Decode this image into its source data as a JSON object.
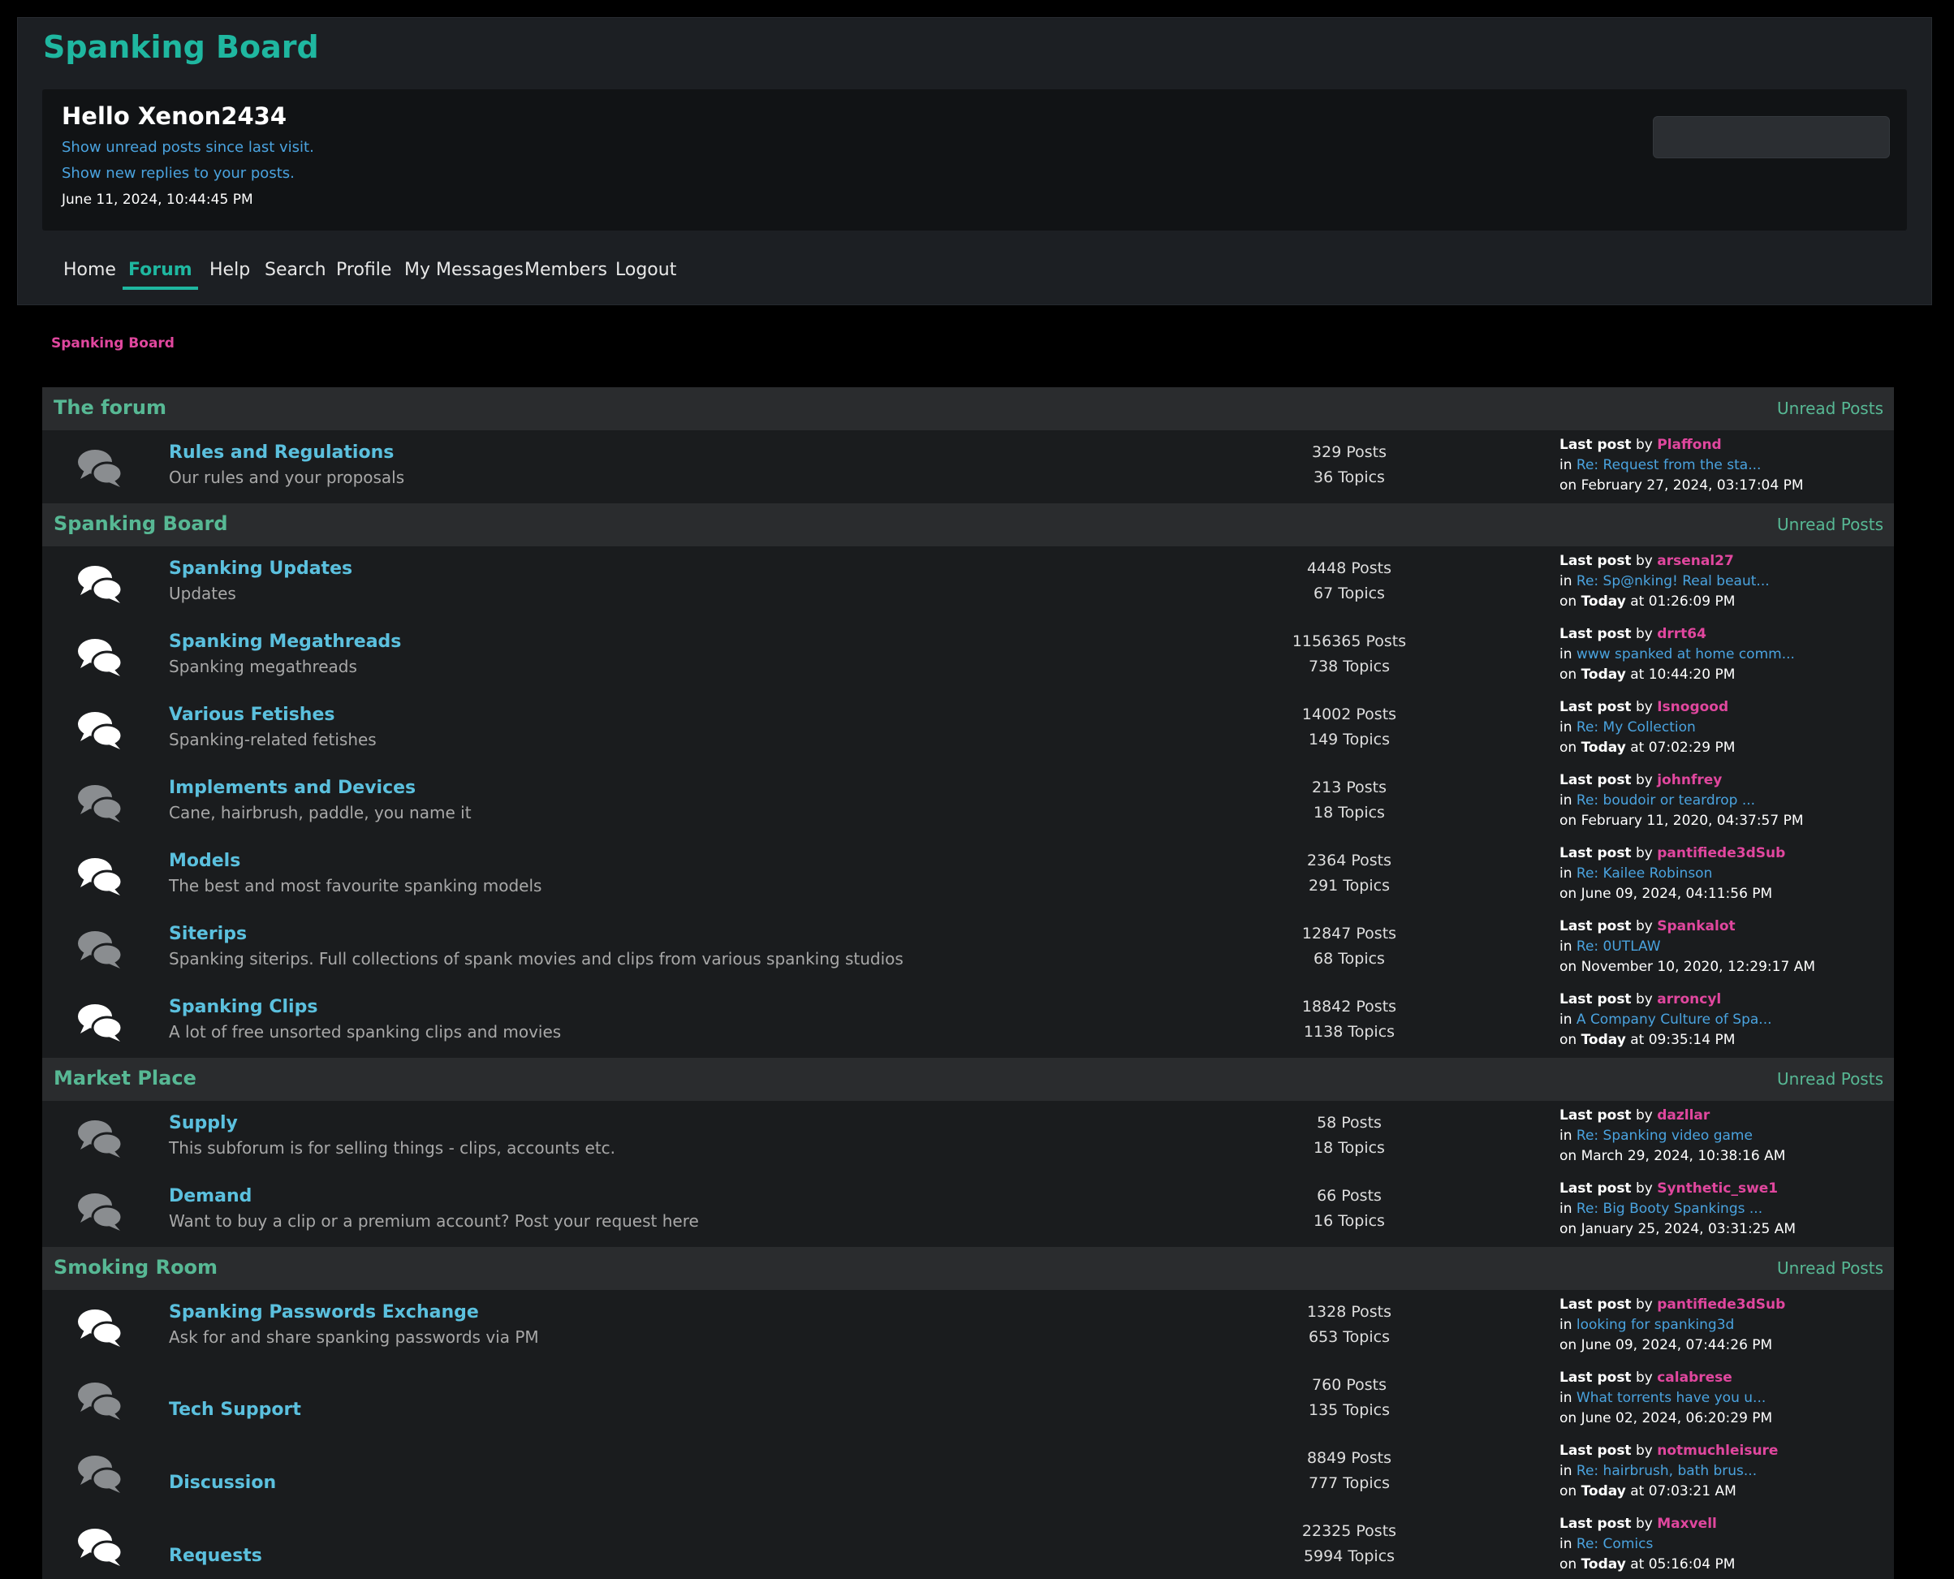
{
  "header": {
    "forum_title": "Spanking Board",
    "greeting": "Hello Xenon2434",
    "unread_link": "Show unread posts since last visit.",
    "replies_link": "Show new replies to your posts.",
    "datetime": "June 11, 2024, 10:44:45 PM"
  },
  "nav": {
    "items": [
      {
        "label": "Home",
        "active": false
      },
      {
        "label": "Forum",
        "active": true
      },
      {
        "label": "Help",
        "active": false
      },
      {
        "label": "Search",
        "active": false
      },
      {
        "label": "Profile",
        "active": false
      },
      {
        "label": "My Messages",
        "active": false
      },
      {
        "label": "Members",
        "active": false
      },
      {
        "label": "Logout",
        "active": false
      }
    ]
  },
  "breadcrumb": "Spanking Board",
  "labels": {
    "last_post": "Last post",
    "by": "by",
    "in": "in",
    "on": "on",
    "unread_posts": "Unread Posts"
  },
  "icons": {
    "board_unread": "speech-bubbles-icon-white",
    "board_read": "speech-bubbles-icon-grey"
  },
  "colors": {
    "accent": "#1fb7a0",
    "category": "#57b894",
    "link": "#4aa3df",
    "board_name": "#5bc0de",
    "poster": "#e0479e"
  },
  "categories": [
    {
      "title": "The forum",
      "boards": [
        {
          "name": "Rules and Regulations",
          "desc": "Our rules and your proposals",
          "posts": "329 Posts",
          "topics": "36 Topics",
          "new": false,
          "last": {
            "by": "Plaffond",
            "topic": "Re: Request from the sta...",
            "date_bold": "",
            "date": "February 27, 2024, 03:17:04 PM"
          }
        }
      ]
    },
    {
      "title": "Spanking Board",
      "boards": [
        {
          "name": "Spanking Updates",
          "desc": "Updates",
          "posts": "4448 Posts",
          "topics": "67 Topics",
          "new": true,
          "last": {
            "by": "arsenal27",
            "topic": "Re: Sp@nking! Real beaut...",
            "date_bold": "Today",
            "date": " at 01:26:09 PM"
          }
        },
        {
          "name": "Spanking Megathreads",
          "desc": "Spanking megathreads",
          "posts": "1156365 Posts",
          "topics": "738 Topics",
          "new": true,
          "last": {
            "by": "drrt64",
            "topic": "www spanked at home comm...",
            "date_bold": "Today",
            "date": " at 10:44:20 PM"
          }
        },
        {
          "name": "Various Fetishes",
          "desc": "Spanking-related fetishes",
          "posts": "14002 Posts",
          "topics": "149 Topics",
          "new": true,
          "last": {
            "by": "Isnogood",
            "topic": "Re: My Collection",
            "date_bold": "Today",
            "date": " at 07:02:29 PM"
          }
        },
        {
          "name": "Implements and Devices",
          "desc": "Cane, hairbrush, paddle, you name it",
          "posts": "213 Posts",
          "topics": "18 Topics",
          "new": false,
          "last": {
            "by": "johnfrey",
            "topic": "Re: boudoir or teardrop ...",
            "date_bold": "",
            "date": "February 11, 2020, 04:37:57 PM"
          }
        },
        {
          "name": "Models",
          "desc": "The best and most favourite spanking models",
          "posts": "2364 Posts",
          "topics": "291 Topics",
          "new": true,
          "last": {
            "by": "pantifiede3dSub",
            "topic": "Re: Kailee Robinson",
            "date_bold": "",
            "date": "June 09, 2024, 04:11:56 PM"
          }
        },
        {
          "name": "Siterips",
          "desc": "Spanking siterips. Full collections of spank movies and clips from various spanking studios",
          "posts": "12847 Posts",
          "topics": "68 Topics",
          "new": false,
          "last": {
            "by": "Spankalot",
            "topic": "Re: 0UTLAW",
            "date_bold": "",
            "date": "November 10, 2020, 12:29:17 AM"
          }
        },
        {
          "name": "Spanking Clips",
          "desc": "A lot of free unsorted spanking clips and movies",
          "posts": "18842 Posts",
          "topics": "1138 Topics",
          "new": true,
          "last": {
            "by": "arroncyl",
            "topic": "A Company Culture of Spa...",
            "date_bold": "Today",
            "date": " at 09:35:14 PM"
          }
        }
      ]
    },
    {
      "title": "Market Place",
      "boards": [
        {
          "name": "Supply",
          "desc": "This subforum is for selling things - clips, accounts etc.",
          "posts": "58 Posts",
          "topics": "18 Topics",
          "new": false,
          "last": {
            "by": "dazllar",
            "topic": "Re: Spanking video game",
            "date_bold": "",
            "date": "March 29, 2024, 10:38:16 AM"
          }
        },
        {
          "name": "Demand",
          "desc": "Want to buy a clip or a premium account? Post your request here",
          "posts": "66 Posts",
          "topics": "16 Topics",
          "new": false,
          "last": {
            "by": "Synthetic_swe1",
            "topic": "Re: Big Booty Spankings ...",
            "date_bold": "",
            "date": "January 25, 2024, 03:31:25 AM"
          }
        }
      ]
    },
    {
      "title": "Smoking Room",
      "boards": [
        {
          "name": "Spanking Passwords Exchange",
          "desc": "Ask for and share spanking passwords via PM",
          "posts": "1328 Posts",
          "topics": "653 Topics",
          "new": true,
          "last": {
            "by": "pantifiede3dSub",
            "topic": "looking for spanking3d",
            "date_bold": "",
            "date": "June 09, 2024, 07:44:26 PM"
          }
        },
        {
          "name": "Tech Support",
          "desc": "",
          "posts": "760 Posts",
          "topics": "135 Topics",
          "new": false,
          "last": {
            "by": "calabrese",
            "topic": "What torrents have you u...",
            "date_bold": "",
            "date": "June 02, 2024, 06:20:29 PM"
          }
        },
        {
          "name": "Discussion",
          "desc": "",
          "posts": "8849 Posts",
          "topics": "777 Topics",
          "new": false,
          "last": {
            "by": "notmuchleisure",
            "topic": "Re: hairbrush, bath brus...",
            "date_bold": "Today",
            "date": " at 07:03:21 AM"
          }
        },
        {
          "name": "Requests",
          "desc": "",
          "posts": "22325 Posts",
          "topics": "5994 Topics",
          "new": true,
          "last": {
            "by": "Maxvell",
            "topic": "Re: Comics",
            "date_bold": "Today",
            "date": " at 05:16:04 PM"
          }
        }
      ]
    }
  ]
}
